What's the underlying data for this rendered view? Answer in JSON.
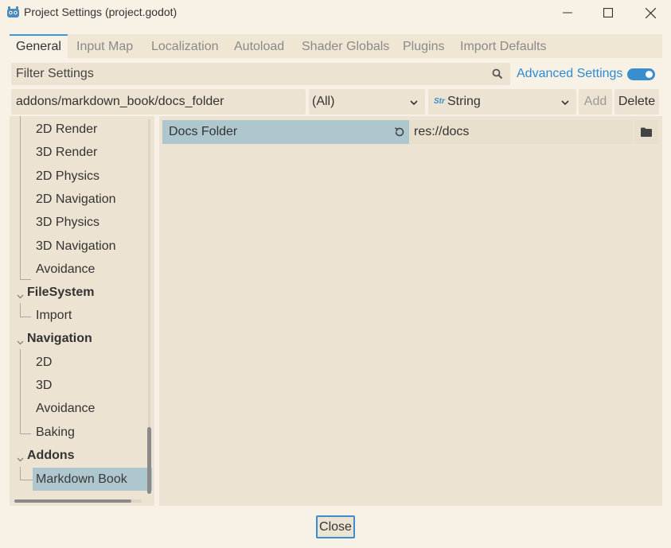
{
  "window": {
    "title": "Project Settings (project.godot)"
  },
  "tabs": [
    {
      "label": "General",
      "active": true
    },
    {
      "label": "Input Map",
      "active": false
    },
    {
      "label": "Localization",
      "active": false
    },
    {
      "label": "Autoload",
      "active": false
    },
    {
      "label": "Shader Globals",
      "active": false
    },
    {
      "label": "Plugins",
      "active": false
    },
    {
      "label": "Import Defaults",
      "active": false
    }
  ],
  "filter": {
    "placeholder": "Filter Settings",
    "advanced_label": "Advanced Settings",
    "advanced_on": true
  },
  "path_row": {
    "path_value": "addons/markdown_book/docs_folder",
    "category_select": "(All)",
    "type_select": "String",
    "type_icon": "Str",
    "add_label": "Add",
    "delete_label": "Delete"
  },
  "tree": {
    "items": [
      {
        "label": "2D Render",
        "kind": "child"
      },
      {
        "label": "3D Render",
        "kind": "child"
      },
      {
        "label": "2D Physics",
        "kind": "child"
      },
      {
        "label": "2D Navigation",
        "kind": "child"
      },
      {
        "label": "3D Physics",
        "kind": "child"
      },
      {
        "label": "3D Navigation",
        "kind": "child"
      },
      {
        "label": "Avoidance",
        "kind": "child"
      },
      {
        "label": "FileSystem",
        "kind": "section"
      },
      {
        "label": "Import",
        "kind": "child"
      },
      {
        "label": "Navigation",
        "kind": "section"
      },
      {
        "label": "2D",
        "kind": "child"
      },
      {
        "label": "3D",
        "kind": "child"
      },
      {
        "label": "Avoidance",
        "kind": "child"
      },
      {
        "label": "Baking",
        "kind": "child"
      },
      {
        "label": "Addons",
        "kind": "section"
      },
      {
        "label": "Markdown Book",
        "kind": "selected"
      }
    ]
  },
  "property": {
    "name": "Docs Folder",
    "value": "res://docs"
  },
  "footer": {
    "close_label": "Close"
  },
  "colors": {
    "accent": "#3a8ed0",
    "selection": "#aec7cf",
    "background": "#f7f1e6",
    "panel": "#ece3d2"
  }
}
